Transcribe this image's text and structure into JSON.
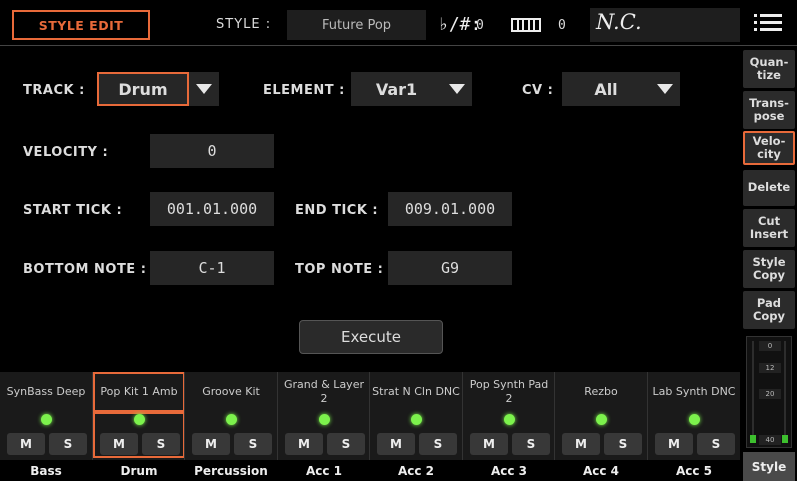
{
  "topbar": {
    "title": "STYLE EDIT",
    "style_label": "STYLE :",
    "style_name": "Future Pop",
    "flat_sharp_symbol": "♭/#:",
    "flat_sharp_value": "0",
    "keyboard_value": "0",
    "chord": "N.C.",
    "menu_icon": "hamburger-menu-icon"
  },
  "fields": {
    "track_label": "TRACK :",
    "track_value": "Drum",
    "element_label": "ELEMENT :",
    "element_value": "Var1",
    "cv_label": "CV :",
    "cv_value": "All",
    "velocity_label": "VELOCITY :",
    "velocity_value": "0",
    "start_tick_label": "START TICK :",
    "start_tick_value": "001.01.000",
    "end_tick_label": "END TICK :",
    "end_tick_value": "009.01.000",
    "bottom_note_label": "BOTTOM NOTE :",
    "bottom_note_value": "C-1",
    "top_note_label": "TOP NOTE :",
    "top_note_value": "G9"
  },
  "execute_label": "Execute",
  "sidebar": {
    "buttons": [
      {
        "label": "Quan-\ntize"
      },
      {
        "label": "Trans-\npose"
      },
      {
        "label": "Velo-\ncity",
        "active": true
      },
      {
        "label": "Delete"
      },
      {
        "label": "Cut\nInsert"
      },
      {
        "label": "Style\nCopy"
      },
      {
        "label": "Pad\nCopy"
      }
    ],
    "meter_ticks": [
      "0",
      "12",
      "20",
      "40"
    ],
    "style_tab": "Style"
  },
  "tracks": [
    {
      "name": "SynBass Deep",
      "type": "Bass",
      "m": "M",
      "s": "S"
    },
    {
      "name": "Pop Kit 1 Amb",
      "type": "Drum",
      "m": "M",
      "s": "S",
      "selected": true
    },
    {
      "name": "Groove Kit",
      "type": "Percussion",
      "m": "M",
      "s": "S"
    },
    {
      "name": "Grand & Layer 2",
      "type": "Acc 1",
      "m": "M",
      "s": "S"
    },
    {
      "name": "Strat N Cln DNC",
      "type": "Acc 2",
      "m": "M",
      "s": "S"
    },
    {
      "name": "Pop Synth Pad 2",
      "type": "Acc 3",
      "m": "M",
      "s": "S"
    },
    {
      "name": "Rezbo",
      "type": "Acc 4",
      "m": "M",
      "s": "S"
    },
    {
      "name": "Lab Synth DNC",
      "type": "Acc 5",
      "m": "M",
      "s": "S"
    }
  ],
  "colors": {
    "accent": "#e86a3a",
    "led_green": "#7cf24c",
    "background": "#000000",
    "field_bg": "#262626"
  }
}
